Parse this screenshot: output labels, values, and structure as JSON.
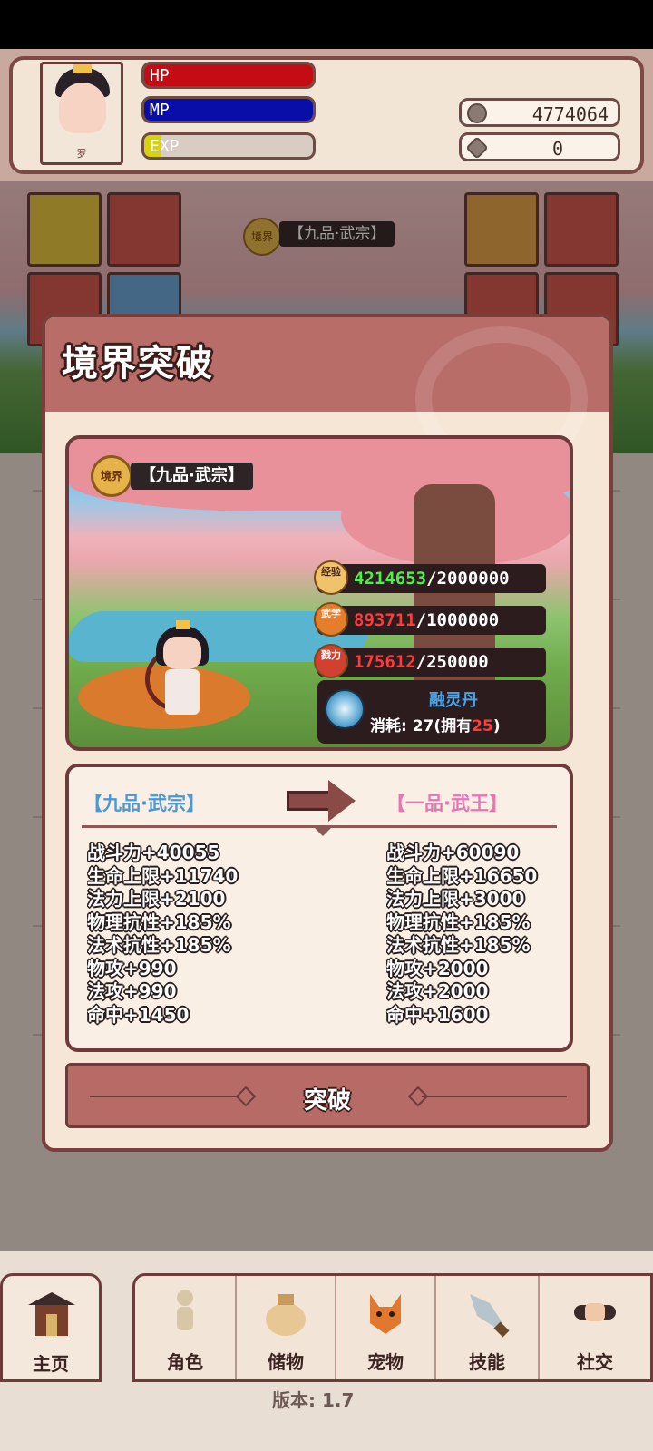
{
  "header": {
    "avatar_name": "罗",
    "hp_label": "HP",
    "mp_label": "MP",
    "exp_label": "EXP",
    "hp_fill": 1.0,
    "mp_fill": 1.0,
    "exp_fill": 0.1,
    "coins": "4774064",
    "gems": "0",
    "coin_icon": "coin-icon",
    "gem_icon": "gem-icon"
  },
  "background_realm": {
    "medal": "境界",
    "text": "【九品·武宗】"
  },
  "modal": {
    "title": "境界突破",
    "realm_medal": "境界",
    "realm_text": "【九品·武宗】",
    "stats": [
      {
        "seal": "经验",
        "current": "4214653",
        "max": "/2000000",
        "color": "#4cf04a"
      },
      {
        "seal": "武学",
        "current": "893711",
        "max": "/1000000",
        "color": "#ff3b3b"
      },
      {
        "seal": "戮力",
        "current": "175612",
        "max": "/250000",
        "color": "#ff3b3b"
      }
    ],
    "item": {
      "name": "融灵丹",
      "cost_prefix": "消耗: 27(拥有",
      "owned": "25",
      "cost_suffix": ")"
    },
    "compare": {
      "from": "【九品·武宗】",
      "to": "【一品·武王】",
      "from_stats": [
        "战斗力+40055",
        "生命上限+11740",
        "法力上限+2100",
        "物理抗性+185%",
        "法术抗性+185%",
        "物攻+990",
        "法攻+990",
        "命中+1450"
      ],
      "to_stats": [
        "战斗力+60090",
        "生命上限+16650",
        "法力上限+3000",
        "物理抗性+185%",
        "法术抗性+185%",
        "物攻+2000",
        "法攻+2000",
        "命中+1600"
      ]
    },
    "button_label": "突破"
  },
  "nav": {
    "home": "主页",
    "items": [
      "角色",
      "储物",
      "宠物",
      "技能",
      "社交"
    ]
  },
  "version": "版本: 1.7",
  "colors": {
    "accent": "#b96d68",
    "border": "#6d3b3a",
    "hp": "#c40c14",
    "mp": "#0a0ea8",
    "exp": "#d7d20a"
  }
}
